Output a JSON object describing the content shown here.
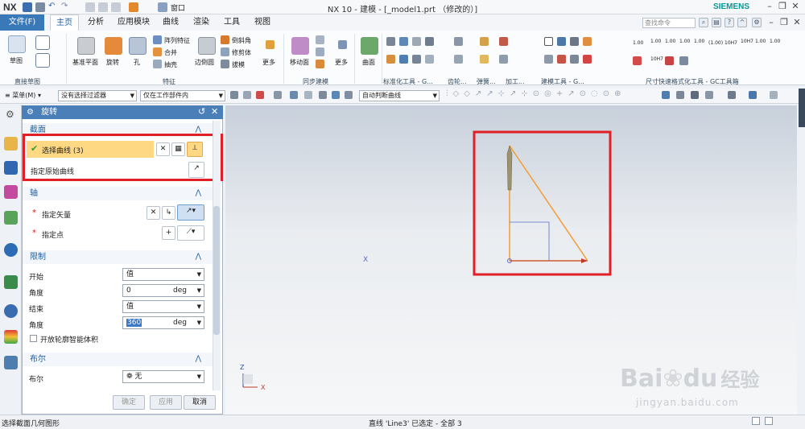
{
  "titlebar": {
    "logo": "NX",
    "title": "NX 10 - 建模 - [_model1.prt （修改的）]",
    "window_menu": "窗口",
    "brand": "SIEMENS"
  },
  "menu": {
    "file": "文件(F)",
    "tabs": [
      "主页",
      "分析",
      "应用模块",
      "曲线",
      "渲染",
      "工具",
      "视图"
    ],
    "search_placeholder": "查找命令"
  },
  "ribbon": {
    "sketch": {
      "label": "草图",
      "group": "直接草图"
    },
    "feature": {
      "items": [
        "基准平面",
        "旋转",
        "孔"
      ],
      "small": [
        "阵列特征",
        "合并",
        "抽壳",
        "边倒圆",
        "倒斜角",
        "修剪体",
        "拔模"
      ],
      "more": "更多",
      "group": "特征"
    },
    "sync": {
      "items": [
        "移动面",
        "更多"
      ],
      "group": "同步建模"
    },
    "surface": {
      "label": "曲面"
    },
    "groups_right": [
      "标准化工具 - G...",
      "齿轮...",
      "弹簧...",
      "加工...",
      "建模工具 - G...",
      "尺寸快速格式化工具 - GC工具箱"
    ],
    "dim_labels": [
      "1.00",
      "1.00",
      "1.00",
      "1.00",
      "(1.00)",
      "10H7",
      "10H7",
      "1.00",
      "1.00",
      "1.00",
      "10H7"
    ]
  },
  "toolbar2": {
    "menu": "菜单(M)",
    "filter": "没有选择过滤器",
    "scope": "仅在工作部件内",
    "curve_rule": "自动判断曲线"
  },
  "dialog": {
    "title": "旋转",
    "section": {
      "header": "截面",
      "select_curve": "选择曲线 (3)",
      "specify_origin": "指定原始曲线"
    },
    "axis": {
      "header": "轴",
      "vector": "指定矢量",
      "point": "指定点"
    },
    "limits": {
      "header": "限制",
      "start": "开始",
      "start_type": "值",
      "angle1_label": "角度",
      "angle1": "0",
      "unit1": "deg",
      "end": "结束",
      "end_type": "值",
      "angle2_label": "角度",
      "angle2": "360",
      "unit2": "deg",
      "open_profile": "开放轮廓智能体积"
    },
    "boolean": {
      "header": "布尔",
      "label": "布尔",
      "value": "无"
    },
    "buttons": {
      "ok": "确定",
      "apply": "应用",
      "cancel": "取消"
    }
  },
  "viewport": {
    "axis_x": "X",
    "axis_z": "Z",
    "sketch_x": "X"
  },
  "watermark": {
    "brand": "Bai",
    "brand2": "du",
    "cn": "经验",
    "url": "jingyan.baidu.com"
  },
  "status": {
    "left": "选择截面几何图形",
    "center": "直线 'Line3' 已选定 - 全部 3"
  },
  "colors": {
    "accent": "#4a7fb8",
    "highlight": "#e01f26",
    "selected_row": "#ffd884",
    "sketch_line": "#f39c34"
  }
}
